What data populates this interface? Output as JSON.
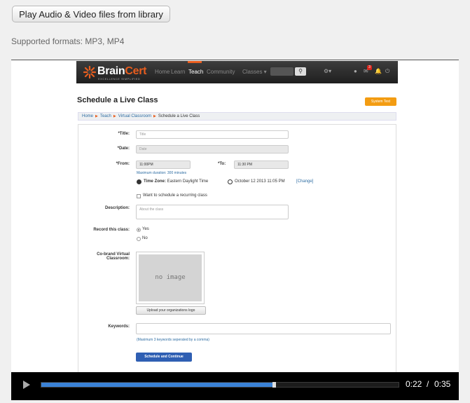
{
  "top_button": {
    "label": "Play Audio & Video files from library"
  },
  "supported_formats": "Supported formats: MP3, MP4",
  "brand": {
    "name_brain": "Brain",
    "name_cert": "Cert",
    "tagline": "EXCELLENCE SIMPLIFIED",
    "accent": "#e85d1e"
  },
  "nav": {
    "items": [
      {
        "label": "Home",
        "active": false
      },
      {
        "label": "Learn",
        "active": false
      },
      {
        "label": "Teach",
        "active": true
      },
      {
        "label": "Community",
        "active": false
      },
      {
        "label": "Classes",
        "active": false
      }
    ],
    "badge": "3"
  },
  "page": {
    "title": "Schedule a Live Class",
    "system_test": "System Test",
    "breadcrumb": [
      "Home",
      "Teach",
      "Virtual Classroom",
      "Schedule a Live Class"
    ]
  },
  "form": {
    "title_label": "*Title:",
    "title_placeholder": "Title",
    "date_label": "*Date:",
    "date_placeholder": "Date",
    "from_label": "*From:",
    "from_value": "11:00PM",
    "to_label": "*To:",
    "to_value": "11:30 PM",
    "max_duration": "Maximum duration: 300 minutes",
    "timezone_label": "Time Zone:",
    "timezone_value": "Eastern Daylight Time",
    "current_time": "October 12 2013 11:05 PM",
    "change_link": "[Change]",
    "recurring_label": "Want to schedule a recurring class",
    "description_label": "Description:",
    "description_placeholder": "About the class",
    "record_label": "Record this class:",
    "record_yes": "Yes",
    "record_no": "No",
    "cobrand_label": "Co-brand Virtual Classroom:",
    "no_image": "no image",
    "upload_label": "Upload your organizations logo",
    "keywords_label": "Keywords:",
    "keywords_note": "(Maximum 3 keywords seperated by a comma)",
    "submit_label": "Schedule and Continue"
  },
  "player": {
    "current_time": "0:22",
    "separator": "/",
    "duration": "0:35",
    "progress": 0.647,
    "progress_color": "#3b82d6"
  }
}
